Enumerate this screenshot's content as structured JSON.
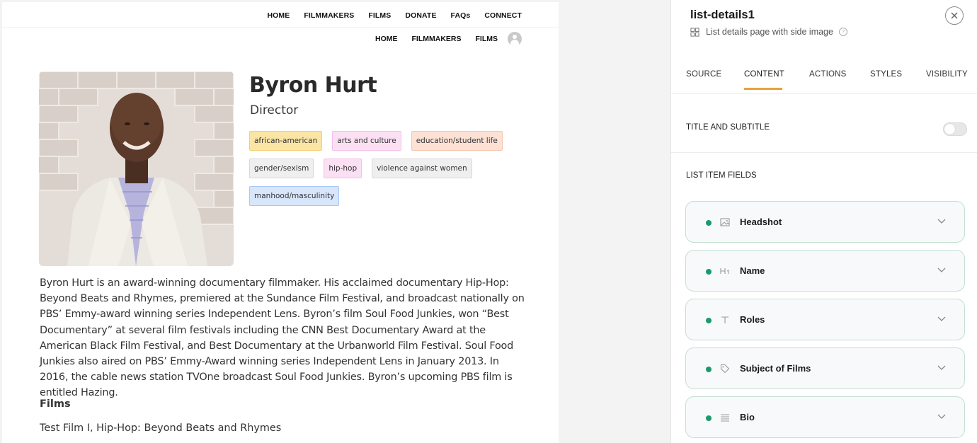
{
  "rail": {
    "globe_icon": "globe-icon",
    "bag_icon": "shopping-bag-icon"
  },
  "preview": {
    "nav_primary": [
      "HOME",
      "FILMMAKERS",
      "FILMS",
      "DONATE",
      "FAQs",
      "CONNECT"
    ],
    "nav_secondary": [
      "HOME",
      "FILMMAKERS",
      "FILMS"
    ],
    "name": "Byron Hurt",
    "role": "Director",
    "tags": [
      "african-american",
      "arts and culture",
      "education/student life",
      "gender/sexism",
      "hip-hop",
      "violence against women",
      "manhood/masculinity"
    ],
    "bio": "Byron Hurt is an award-winning documentary filmmaker. His acclaimed documentary Hip-Hop: Beyond Beats and Rhymes, premiered at the Sundance Film Festival, and broadcast nationally on PBS’ Emmy-award winning series Independent Lens. Byron’s film Soul Food Junkies, won “Best Documentary” at several film festivals including the CNN Best Documentary Award at the American Black Film Festival, and Best Documentary at the Urbanworld Film Festival. Soul Food Junkies also aired on PBS’ Emmy-Award winning series Independent Lens in January 2013. In 2016, the cable news station TVOne broadcast Soul Food Junkies. Byron’s upcoming PBS film is entitled Hazing.",
    "films_heading": "Films",
    "films_value": "Test Film I, Hip-Hop: Beyond Beats and Rhymes"
  },
  "panel": {
    "title": "list-details1",
    "subtitle": "List details page with side image",
    "tabs": [
      "SOURCE",
      "CONTENT",
      "ACTIONS",
      "STYLES",
      "VISIBILITY"
    ],
    "active_tab": "CONTENT",
    "title_subtitle_label": "TITLE AND SUBTITLE",
    "title_subtitle_enabled": false,
    "list_item_fields_label": "LIST ITEM FIELDS",
    "fields": [
      {
        "label": "Headshot",
        "icon": "image-icon"
      },
      {
        "label": "Name",
        "icon": "heading-icon"
      },
      {
        "label": "Roles",
        "icon": "text-icon"
      },
      {
        "label": "Subject of Films",
        "icon": "tag-icon"
      },
      {
        "label": "Bio",
        "icon": "paragraph-icon"
      }
    ],
    "accent_color": "#e6a23c",
    "field_dot_color": "#1b9a6a"
  }
}
